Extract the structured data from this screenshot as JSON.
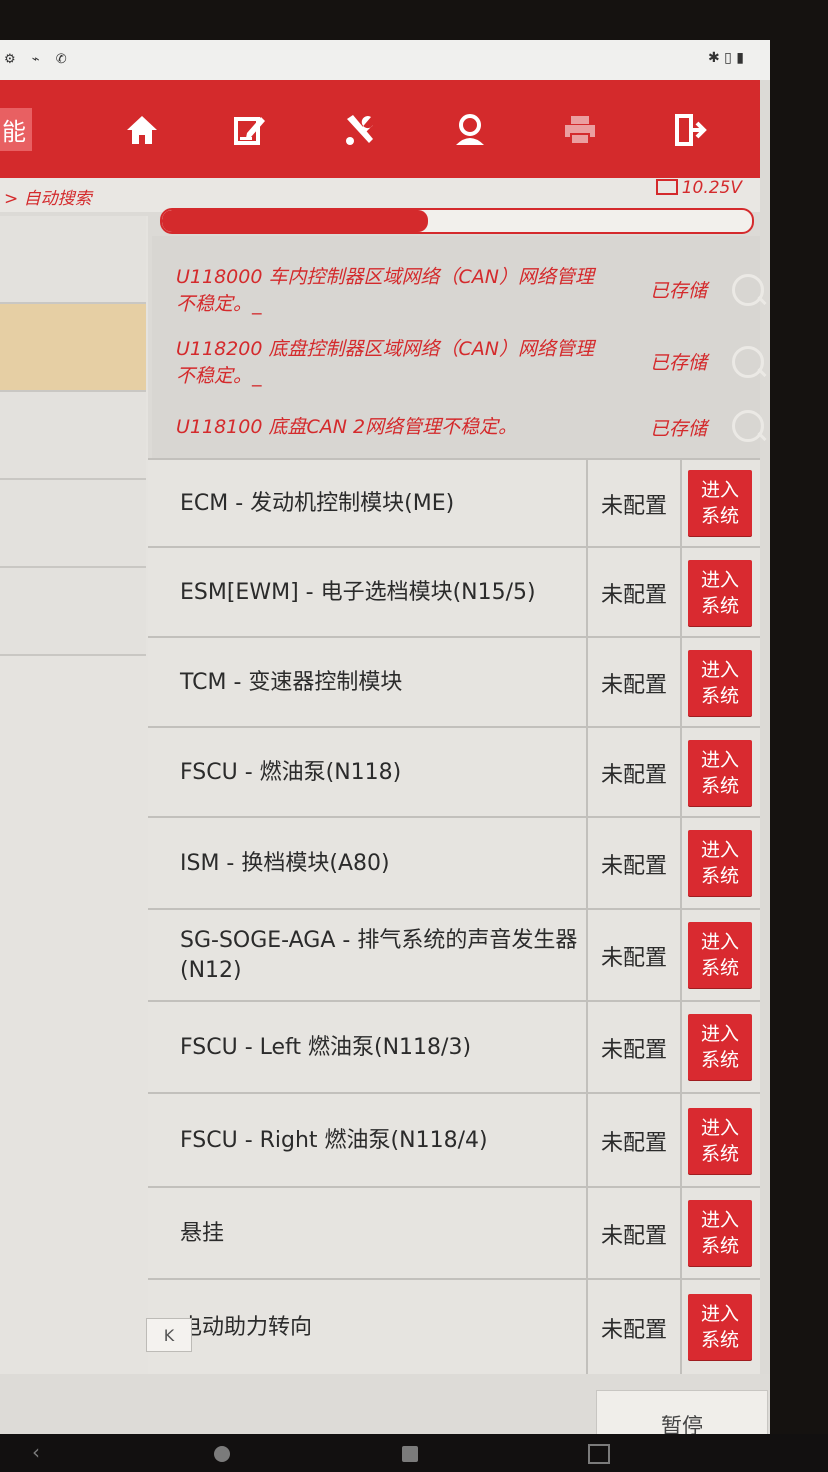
{
  "status_bar": {
    "left_icons": "⚙ ⌁ ✆",
    "right_icons": "✱ ▯ ▮"
  },
  "toolbar": {
    "function_label": "能",
    "icons": [
      "home-icon",
      "edit-icon",
      "tools-icon",
      "user-icon",
      "print-icon",
      "exit-icon"
    ]
  },
  "breadcrumb": {
    "text": "> 自动搜索"
  },
  "voltage": "10.25V",
  "progress": {
    "percent": 45
  },
  "dtc_list": [
    {
      "text": "U118000 车内控制器区域网络（CAN）网络管理不稳定。_",
      "status": "已存储"
    },
    {
      "text": "U118200 底盘控制器区域网络（CAN）网络管理不稳定。_",
      "status": "已存储"
    },
    {
      "text": "U118100 底盘CAN 2网络管理不稳定。",
      "status": "已存储"
    }
  ],
  "modules": [
    {
      "name": "ECM - 发动机控制模块(ME)",
      "status": "未配置",
      "button": "进入系统"
    },
    {
      "name": "ESM[EWM] - 电子选档模块(N15/5)",
      "status": "未配置",
      "button": "进入系统"
    },
    {
      "name": "TCM - 变速器控制模块",
      "status": "未配置",
      "button": "进入系统"
    },
    {
      "name": "FSCU - 燃油泵(N118)",
      "status": "未配置",
      "button": "进入系统"
    },
    {
      "name": "ISM - 换档模块(A80)",
      "status": "未配置",
      "button": "进入系统"
    },
    {
      "name": "SG-SOGE-AGA - 排气系统的声音发生器(N12)",
      "status": "未配置",
      "button": "进入系统"
    },
    {
      "name": "FSCU - Left 燃油泵(N118/3)",
      "status": "未配置",
      "button": "进入系统"
    },
    {
      "name": "FSCU - Right 燃油泵(N118/4)",
      "status": "未配置",
      "button": "进入系统"
    },
    {
      "name": "悬挂",
      "status": "未配置",
      "button": "进入系统"
    },
    {
      "name": "电动助力转向",
      "status": "未配置",
      "button": "进入系统"
    }
  ],
  "collapse_button": "K",
  "pause_button": "暂停",
  "nav": {
    "back": "‹"
  }
}
